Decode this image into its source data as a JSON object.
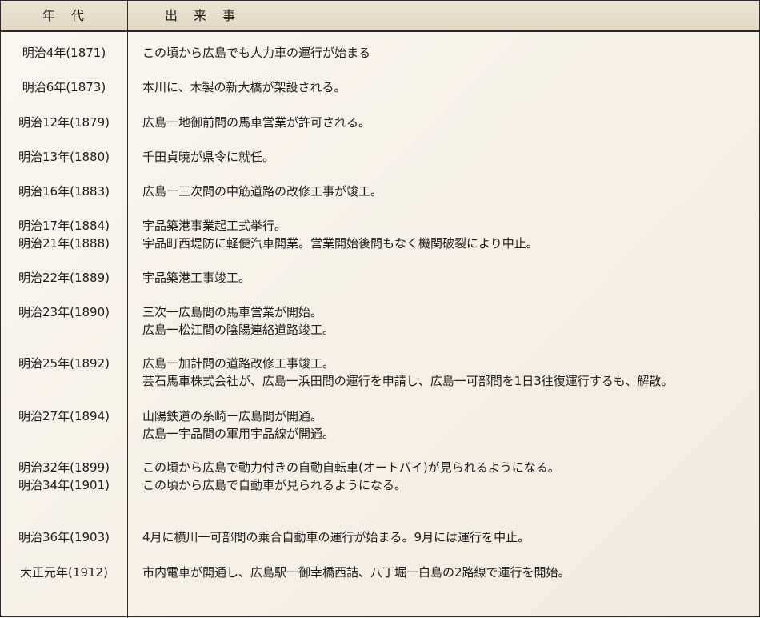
{
  "header": {
    "year_label": "年　代",
    "event_label": "出　来　事"
  },
  "rows": [
    {
      "years": [
        "明治4年(1871)"
      ],
      "events": [
        "この頃から広島でも人力車の運行が始まる"
      ]
    },
    {
      "years": [
        "明治6年(1873)"
      ],
      "events": [
        "本川に、木製の新大橋が架設される。"
      ]
    },
    {
      "years": [
        "明治12年(1879)"
      ],
      "events": [
        "広島一地御前間の馬車営業が許可される。"
      ]
    },
    {
      "years": [
        "明治13年(1880)"
      ],
      "events": [
        "千田貞暁が県令に就任。"
      ]
    },
    {
      "years": [
        "明治16年(1883)"
      ],
      "events": [
        "広島一三次間の中筋道路の改修工事が竣工。"
      ]
    },
    {
      "years": [
        "明治17年(1884)",
        "明治21年(1888)"
      ],
      "events": [
        "宇品築港事業起工式挙行。",
        "宇品町西堤防に軽便汽車開業。営業開始後間もなく機関破裂により中止。"
      ]
    },
    {
      "years": [
        "明治22年(1889)"
      ],
      "events": [
        "宇品築港工事竣工。"
      ]
    },
    {
      "years": [
        "明治23年(1890)"
      ],
      "events": [
        "三次一広島間の馬車営業が開始。",
        "広島一松江間の陰陽連絡道路竣工。"
      ]
    },
    {
      "years": [
        "明治25年(1892)"
      ],
      "events": [
        "広島一加計間の道路改修工事竣工。",
        "芸石馬車株式会社が、広島一浜田間の運行を申請し、広島一可部間を1日3往復運行するも、解散。"
      ]
    },
    {
      "years": [
        "明治27年(1894)"
      ],
      "events": [
        "山陽鉄道の糸崎ー広島間が開通。",
        "広島一宇品間の軍用宇品線が開通。"
      ]
    },
    {
      "years": [
        "明治32年(1899)",
        "明治34年(1901)"
      ],
      "events": [
        "この頃から広島で動力付きの自動自転車(オートバイ)が見られるようになる。",
        "この頃から広島で自動車が見られるようになる。"
      ]
    },
    {
      "years": [
        "明治36年(1903)"
      ],
      "events": [
        "4月に横川一可部間の乗合自動車の運行が始まる。9月には運行を中止。"
      ]
    },
    {
      "years": [
        "大正元年(1912)"
      ],
      "events": [
        "市内電車が開通し、広島駅一御幸橋西詰、八丁堀一白島の2路線で運行を開始。"
      ]
    }
  ]
}
